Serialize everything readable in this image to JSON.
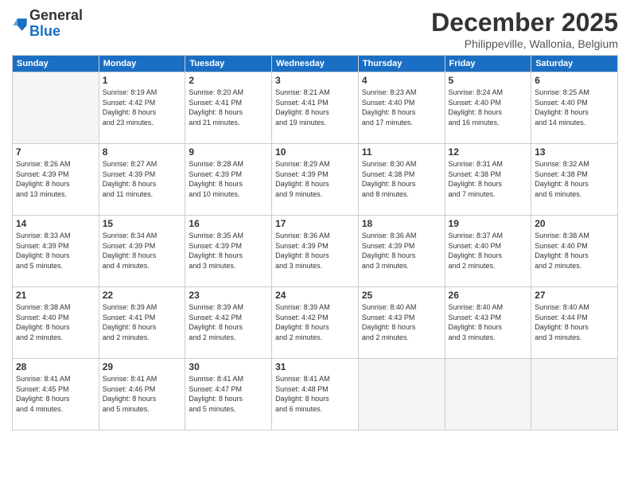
{
  "logo": {
    "general": "General",
    "blue": "Blue"
  },
  "header": {
    "month": "December 2025",
    "location": "Philippeville, Wallonia, Belgium"
  },
  "weekdays": [
    "Sunday",
    "Monday",
    "Tuesday",
    "Wednesday",
    "Thursday",
    "Friday",
    "Saturday"
  ],
  "weeks": [
    [
      {
        "day": "",
        "info": ""
      },
      {
        "day": "1",
        "info": "Sunrise: 8:19 AM\nSunset: 4:42 PM\nDaylight: 8 hours\nand 23 minutes."
      },
      {
        "day": "2",
        "info": "Sunrise: 8:20 AM\nSunset: 4:41 PM\nDaylight: 8 hours\nand 21 minutes."
      },
      {
        "day": "3",
        "info": "Sunrise: 8:21 AM\nSunset: 4:41 PM\nDaylight: 8 hours\nand 19 minutes."
      },
      {
        "day": "4",
        "info": "Sunrise: 8:23 AM\nSunset: 4:40 PM\nDaylight: 8 hours\nand 17 minutes."
      },
      {
        "day": "5",
        "info": "Sunrise: 8:24 AM\nSunset: 4:40 PM\nDaylight: 8 hours\nand 16 minutes."
      },
      {
        "day": "6",
        "info": "Sunrise: 8:25 AM\nSunset: 4:40 PM\nDaylight: 8 hours\nand 14 minutes."
      }
    ],
    [
      {
        "day": "7",
        "info": "Sunrise: 8:26 AM\nSunset: 4:39 PM\nDaylight: 8 hours\nand 13 minutes."
      },
      {
        "day": "8",
        "info": "Sunrise: 8:27 AM\nSunset: 4:39 PM\nDaylight: 8 hours\nand 11 minutes."
      },
      {
        "day": "9",
        "info": "Sunrise: 8:28 AM\nSunset: 4:39 PM\nDaylight: 8 hours\nand 10 minutes."
      },
      {
        "day": "10",
        "info": "Sunrise: 8:29 AM\nSunset: 4:39 PM\nDaylight: 8 hours\nand 9 minutes."
      },
      {
        "day": "11",
        "info": "Sunrise: 8:30 AM\nSunset: 4:38 PM\nDaylight: 8 hours\nand 8 minutes."
      },
      {
        "day": "12",
        "info": "Sunrise: 8:31 AM\nSunset: 4:38 PM\nDaylight: 8 hours\nand 7 minutes."
      },
      {
        "day": "13",
        "info": "Sunrise: 8:32 AM\nSunset: 4:38 PM\nDaylight: 8 hours\nand 6 minutes."
      }
    ],
    [
      {
        "day": "14",
        "info": "Sunrise: 8:33 AM\nSunset: 4:39 PM\nDaylight: 8 hours\nand 5 minutes."
      },
      {
        "day": "15",
        "info": "Sunrise: 8:34 AM\nSunset: 4:39 PM\nDaylight: 8 hours\nand 4 minutes."
      },
      {
        "day": "16",
        "info": "Sunrise: 8:35 AM\nSunset: 4:39 PM\nDaylight: 8 hours\nand 3 minutes."
      },
      {
        "day": "17",
        "info": "Sunrise: 8:36 AM\nSunset: 4:39 PM\nDaylight: 8 hours\nand 3 minutes."
      },
      {
        "day": "18",
        "info": "Sunrise: 8:36 AM\nSunset: 4:39 PM\nDaylight: 8 hours\nand 3 minutes."
      },
      {
        "day": "19",
        "info": "Sunrise: 8:37 AM\nSunset: 4:40 PM\nDaylight: 8 hours\nand 2 minutes."
      },
      {
        "day": "20",
        "info": "Sunrise: 8:38 AM\nSunset: 4:40 PM\nDaylight: 8 hours\nand 2 minutes."
      }
    ],
    [
      {
        "day": "21",
        "info": "Sunrise: 8:38 AM\nSunset: 4:40 PM\nDaylight: 8 hours\nand 2 minutes."
      },
      {
        "day": "22",
        "info": "Sunrise: 8:39 AM\nSunset: 4:41 PM\nDaylight: 8 hours\nand 2 minutes."
      },
      {
        "day": "23",
        "info": "Sunrise: 8:39 AM\nSunset: 4:42 PM\nDaylight: 8 hours\nand 2 minutes."
      },
      {
        "day": "24",
        "info": "Sunrise: 8:39 AM\nSunset: 4:42 PM\nDaylight: 8 hours\nand 2 minutes."
      },
      {
        "day": "25",
        "info": "Sunrise: 8:40 AM\nSunset: 4:43 PM\nDaylight: 8 hours\nand 2 minutes."
      },
      {
        "day": "26",
        "info": "Sunrise: 8:40 AM\nSunset: 4:43 PM\nDaylight: 8 hours\nand 3 minutes."
      },
      {
        "day": "27",
        "info": "Sunrise: 8:40 AM\nSunset: 4:44 PM\nDaylight: 8 hours\nand 3 minutes."
      }
    ],
    [
      {
        "day": "28",
        "info": "Sunrise: 8:41 AM\nSunset: 4:45 PM\nDaylight: 8 hours\nand 4 minutes."
      },
      {
        "day": "29",
        "info": "Sunrise: 8:41 AM\nSunset: 4:46 PM\nDaylight: 8 hours\nand 5 minutes."
      },
      {
        "day": "30",
        "info": "Sunrise: 8:41 AM\nSunset: 4:47 PM\nDaylight: 8 hours\nand 5 minutes."
      },
      {
        "day": "31",
        "info": "Sunrise: 8:41 AM\nSunset: 4:48 PM\nDaylight: 8 hours\nand 6 minutes."
      },
      {
        "day": "",
        "info": ""
      },
      {
        "day": "",
        "info": ""
      },
      {
        "day": "",
        "info": ""
      }
    ]
  ]
}
